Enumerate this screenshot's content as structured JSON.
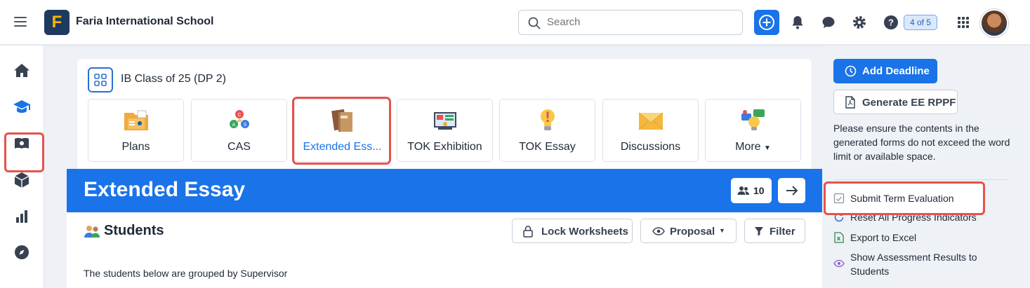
{
  "header": {
    "school_name": "Faria International School",
    "logo_letter": "F",
    "search_placeholder": "Search",
    "notification_count": "4 of 5",
    "icons": [
      "menu-icon",
      "plus-icon",
      "bell-icon",
      "chat-icon",
      "gear-icon",
      "help-icon",
      "apps-grid-icon"
    ]
  },
  "sidebar": {
    "items": [
      {
        "name": "home-icon"
      },
      {
        "name": "graduation-cap-icon",
        "active": true
      },
      {
        "name": "book-icon"
      },
      {
        "name": "cube-icon"
      },
      {
        "name": "bar-chart-icon"
      },
      {
        "name": "compass-icon"
      }
    ]
  },
  "class": {
    "title": "IB Class of 25 (DP 2)",
    "tiles": [
      {
        "label": "Plans",
        "icon": "plans-folder-icon"
      },
      {
        "label": "CAS",
        "icon": "cas-triangle-icon"
      },
      {
        "label": "Extended Ess...",
        "icon": "books-icon",
        "active": true
      },
      {
        "label": "TOK Exhibition",
        "icon": "exhibition-screen-icon"
      },
      {
        "label": "TOK Essay",
        "icon": "lightbulb-exclamation-icon"
      },
      {
        "label": "Discussions",
        "icon": "envelope-icon"
      },
      {
        "label": "More",
        "icon": "chat-lightbulb-icon"
      }
    ]
  },
  "banner": {
    "title": "Extended Essay",
    "member_count": "10"
  },
  "students": {
    "title": "Students",
    "lock_label": "Lock Worksheets",
    "proposal_label": "Proposal",
    "filter_label": "Filter",
    "note": "The students below are grouped by Supervisor"
  },
  "right_panel": {
    "add_deadline_label": "Add Deadline",
    "generate_label": "Generate EE RPPF",
    "note": "Please ensure the contents in the generated forms do not exceed the word limit or available space.",
    "actions": [
      {
        "label": "Submit Term Evaluation",
        "icon": "checkbox-doc-icon"
      },
      {
        "label": "Reset All Progress Indicators",
        "icon": "refresh-icon"
      },
      {
        "label": "Export to Excel",
        "icon": "excel-icon"
      },
      {
        "label": "Show Assessment Results to",
        "label2": "Students",
        "icon": "eye-icon"
      }
    ]
  },
  "colors": {
    "primary": "#1a73e8",
    "highlight": "#e5534b",
    "logo_bg": "#1e3a5f",
    "logo_fg": "#f5b700"
  }
}
